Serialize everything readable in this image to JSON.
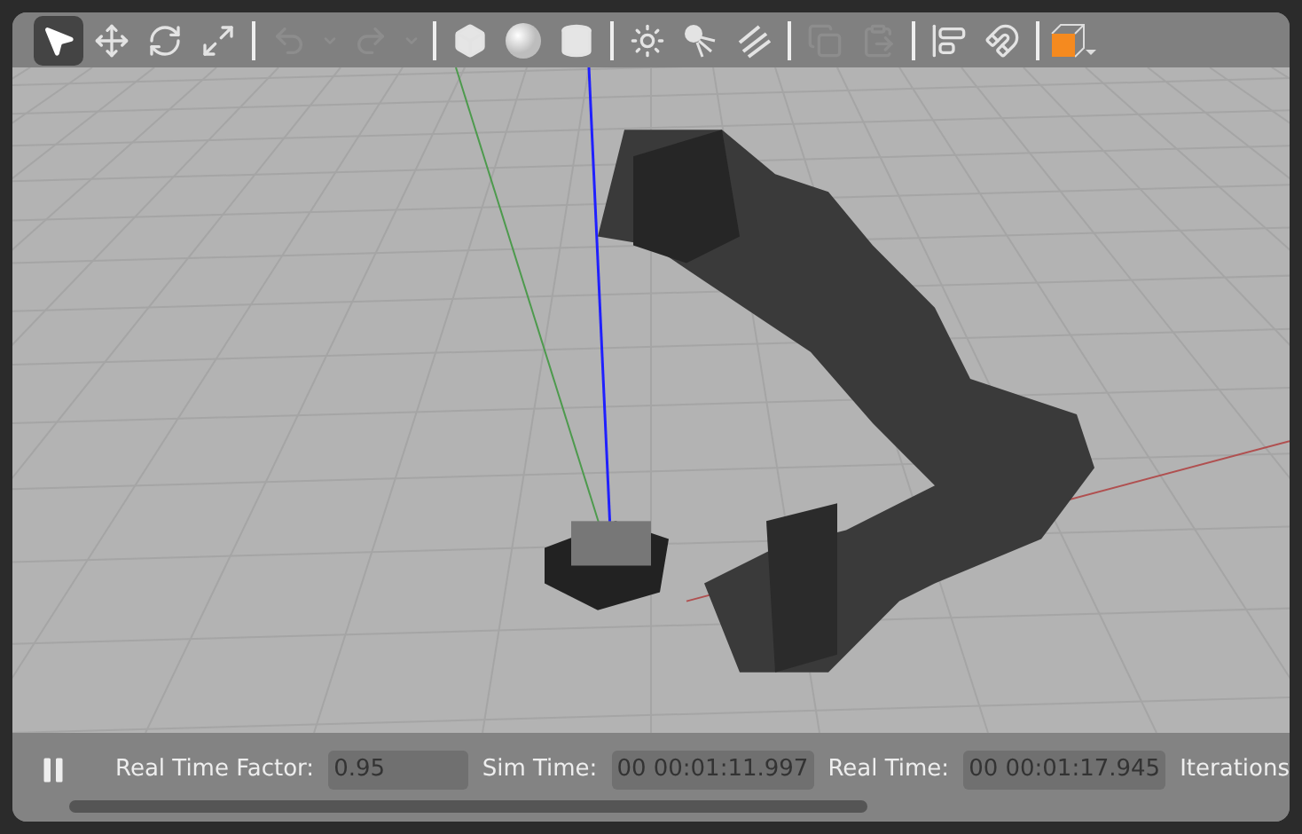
{
  "toolbar": {
    "groups": [
      [
        {
          "kind": "select",
          "selected": true,
          "disabled": false
        },
        {
          "kind": "translate",
          "selected": false,
          "disabled": false
        },
        {
          "kind": "rotate",
          "selected": false,
          "disabled": false
        },
        {
          "kind": "scale",
          "selected": false,
          "disabled": false
        }
      ],
      [
        {
          "kind": "undo",
          "selected": false,
          "disabled": true
        },
        {
          "kind": "caret",
          "selected": false,
          "disabled": true
        },
        {
          "kind": "redo",
          "selected": false,
          "disabled": true
        },
        {
          "kind": "caret",
          "selected": false,
          "disabled": true
        }
      ],
      [
        {
          "kind": "box",
          "selected": false,
          "disabled": false
        },
        {
          "kind": "sphere",
          "selected": false,
          "disabled": false
        },
        {
          "kind": "cylinder",
          "selected": false,
          "disabled": false
        }
      ],
      [
        {
          "kind": "point_light",
          "selected": false,
          "disabled": false
        },
        {
          "kind": "spot_light",
          "selected": false,
          "disabled": false
        },
        {
          "kind": "directional_light",
          "selected": false,
          "disabled": false
        }
      ],
      [
        {
          "kind": "copy",
          "selected": false,
          "disabled": true
        },
        {
          "kind": "paste",
          "selected": false,
          "disabled": true
        }
      ],
      [
        {
          "kind": "align",
          "selected": false,
          "disabled": false
        },
        {
          "kind": "snap",
          "selected": false,
          "disabled": false
        }
      ],
      [
        {
          "kind": "view_angle",
          "selected": false,
          "disabled": false
        }
      ]
    ]
  },
  "status_bar": {
    "paused": true,
    "fields": [
      {
        "label": "Real Time Factor:",
        "value": "0.95"
      },
      {
        "label": "Sim Time:",
        "value": "00 00:01:11.997"
      },
      {
        "label": "Real Time:",
        "value": "00 00:01:17.945"
      },
      {
        "label": "Iterations"
      }
    ]
  }
}
